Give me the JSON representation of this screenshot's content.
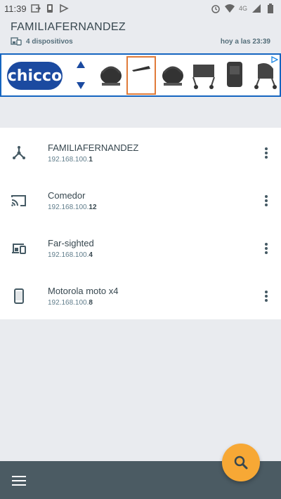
{
  "status_bar": {
    "time": "11:39",
    "network": "4G",
    "left_icons": [
      "cast-icon",
      "phone-icon",
      "forward-icon"
    ],
    "right_icons": [
      "alarm-icon",
      "wifi-icon",
      "signal-icon",
      "battery-icon"
    ]
  },
  "header": {
    "title": "FAMILIAFERNANDEZ",
    "device_count": "4 dispositivos",
    "last_scan": "hoy a las 23:39"
  },
  "ad": {
    "brand": "chicco",
    "products": [
      "car-seat",
      "car-seat-base",
      "car-seat",
      "double-stroller",
      "booster-seat",
      "stroller"
    ]
  },
  "devices": [
    {
      "name": "FAMILIAFERNANDEZ",
      "ip_prefix": "192.168.100.",
      "ip_suffix": "1",
      "icon": "router-icon"
    },
    {
      "name": "Comedor",
      "ip_prefix": "192.168.100.",
      "ip_suffix": "12",
      "icon": "cast-icon"
    },
    {
      "name": "Far-sighted",
      "ip_prefix": "192.168.100.",
      "ip_suffix": "4",
      "icon": "devices-icon"
    },
    {
      "name": "Motorola moto x4",
      "ip_prefix": "192.168.100.",
      "ip_suffix": "8",
      "icon": "phone-icon"
    }
  ],
  "colors": {
    "fab": "#f7a835",
    "bottom_bar": "#4b5b63",
    "ad_border": "#1565c0",
    "background": "#e9ebef"
  }
}
